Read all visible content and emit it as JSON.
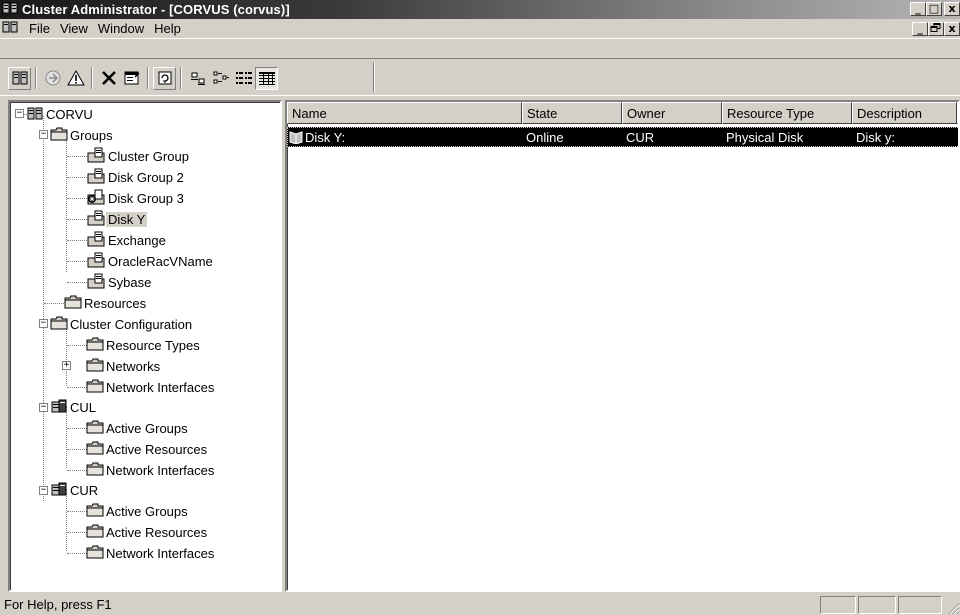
{
  "window": {
    "title": "Cluster Administrator - [CORVUS (corvus)]",
    "minimize": "_",
    "maximize": "□",
    "close": "x",
    "restore": "🗗"
  },
  "menu": {
    "items": [
      "File",
      "View",
      "Window",
      "Help"
    ]
  },
  "toolbar": {
    "icons": [
      "open-connection-icon",
      "bring-online-icon",
      "take-offline-icon",
      "delete-icon",
      "properties-icon",
      "refresh-icon",
      "large-icons-view-icon",
      "small-icons-view-icon",
      "list-view-icon",
      "details-view-icon"
    ]
  },
  "tree": {
    "root": "CORVU",
    "groups_label": "Groups",
    "groups": [
      "Cluster Group",
      "Disk Group 2",
      "Disk Group 3",
      "Disk Y",
      "Exchange",
      "OracleRacVName",
      "Sybase"
    ],
    "selected": "Disk Y",
    "resources": "Resources",
    "cluster_config": "Cluster Configuration",
    "config_items": [
      "Resource Types",
      "Networks",
      "Network Interfaces"
    ],
    "nodes": [
      {
        "name": "CUL",
        "items": [
          "Active Groups",
          "Active Resources",
          "Network Interfaces"
        ]
      },
      {
        "name": "CUR",
        "items": [
          "Active Groups",
          "Active Resources",
          "Network Interfaces"
        ]
      }
    ]
  },
  "list": {
    "columns": [
      "Name",
      "State",
      "Owner",
      "Resource Type",
      "Description"
    ],
    "rows": [
      {
        "name": "Disk Y:",
        "state": "Online",
        "owner": "CUR",
        "type": "Physical Disk",
        "description": "Disk y:"
      }
    ]
  },
  "status": {
    "text": "For Help, press F1"
  }
}
